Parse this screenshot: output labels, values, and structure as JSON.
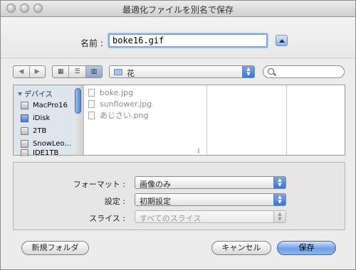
{
  "window": {
    "title": "最適化ファイルを別名で保存"
  },
  "save": {
    "name_label": "名前 :",
    "name_value": "boke16.gif"
  },
  "toolbar": {
    "nav_back_icon": "arrow-left-icon",
    "nav_forward_icon": "arrow-right-icon",
    "views": [
      "icon-view",
      "list-view",
      "column-view"
    ],
    "active_view": "column-view",
    "location": "花",
    "search_placeholder": ""
  },
  "sidebar": {
    "heading": "デバイス",
    "items": [
      {
        "label": "MacPro16",
        "icon": "computer-icon"
      },
      {
        "label": "iDisk",
        "icon": "idisk-icon"
      },
      {
        "label": "2TB",
        "icon": "drive-icon"
      },
      {
        "label": "SnowLeo...",
        "icon": "drive-icon"
      },
      {
        "label": "IDE1TB",
        "icon": "drive-icon"
      }
    ]
  },
  "files": [
    {
      "name": "boke.jpg"
    },
    {
      "name": "sunflower.jpg"
    },
    {
      "name": "あじさい.png"
    }
  ],
  "options": {
    "format": {
      "label": "フォーマット :",
      "value": "画像のみ"
    },
    "settings": {
      "label": "設定 :",
      "value": "初期設定"
    },
    "slices": {
      "label": "スライス :",
      "value": "すべてのスライス",
      "disabled": true
    }
  },
  "buttons": {
    "new_folder": "新規フォルダ",
    "cancel": "キャンセル",
    "save": "保存"
  },
  "colors": {
    "accent": "#3b75d0",
    "focus_ring": "#7aa7e0",
    "sidebar_bg": "#dfe5ed"
  }
}
